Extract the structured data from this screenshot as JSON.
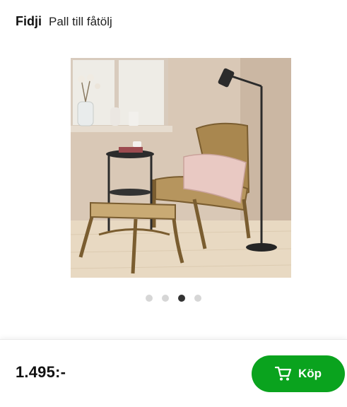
{
  "product": {
    "brand": "Fidji",
    "subtitle": "Pall till fåtölj",
    "image_description_icon": "product-photo",
    "price": "1.495:-"
  },
  "carousel": {
    "total": 4,
    "active_index": 3
  },
  "actions": {
    "buy_label": "Köp",
    "buy_icon": "cart-icon"
  },
  "colors": {
    "accent": "#0aa31e",
    "dot_active": "#333333",
    "dot_inactive": "#d6d6d6"
  }
}
